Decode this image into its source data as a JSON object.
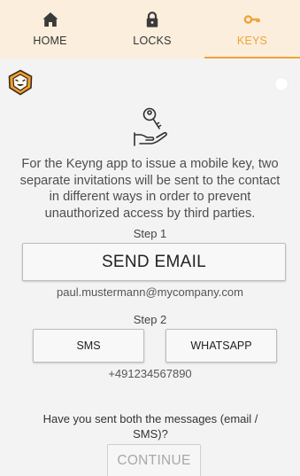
{
  "tabs": [
    {
      "label": "HOME",
      "icon": "home-icon"
    },
    {
      "label": "LOCKS",
      "icon": "lock-icon"
    },
    {
      "label": "KEYS",
      "icon": "key-icon",
      "active": true
    }
  ],
  "colors": {
    "accent": "#f0a33a",
    "tabbar_bg": "#fbeedd",
    "background": "#f3f3f3"
  },
  "intro_text": "For the Keyng app to issue a mobile key, two separate invitations will be sent to the contact in different ways in order to prevent unauthorized access by third parties.",
  "step1": {
    "label": "Step 1",
    "button": "SEND EMAIL",
    "email": "paul.mustermann@mycompany.com"
  },
  "step2": {
    "label": "Step 2",
    "sms_button": "SMS",
    "whatsapp_button": "WHATSAPP",
    "phone": "+491234567890"
  },
  "question": "Have you sent both the messages (email / SMS)?",
  "continue_button": "CONTINUE"
}
